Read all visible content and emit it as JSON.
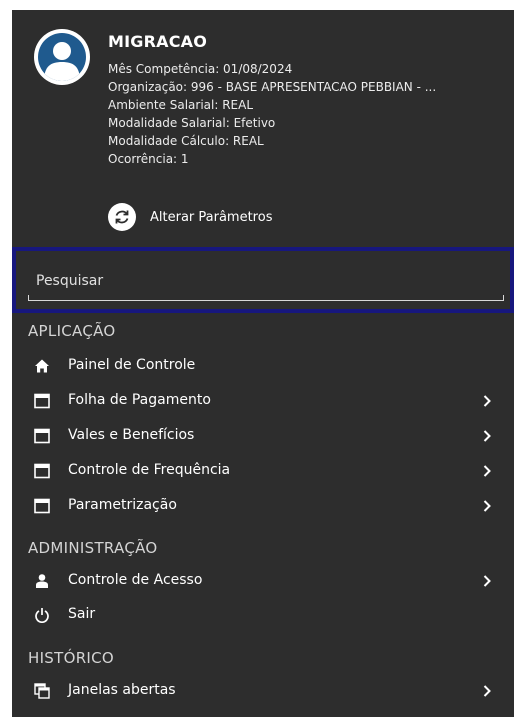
{
  "profile": {
    "name": "MIGRACAO",
    "lines": [
      "Mês Competência: 01/08/2024",
      "Organização: 996 - BASE APRESENTACAO PEBBIAN - ...",
      "Ambiente Salarial: REAL",
      "Modalidade Salarial: Efetivo",
      "Modalidade Cálculo: REAL",
      "Ocorrência: 1"
    ],
    "change_params_label": "Alterar Parâmetros"
  },
  "search": {
    "placeholder": "Pesquisar",
    "value": ""
  },
  "sections": {
    "aplicacao": {
      "title": "APLICAÇÃO",
      "items": [
        {
          "label": "Painel de Controle",
          "icon": "home-icon",
          "has_submenu": false
        },
        {
          "label": "Folha de Pagamento",
          "icon": "window-icon",
          "has_submenu": true
        },
        {
          "label": "Vales e Benefícios",
          "icon": "window-icon",
          "has_submenu": true
        },
        {
          "label": "Controle de Frequência",
          "icon": "window-icon",
          "has_submenu": true
        },
        {
          "label": "Parametrização",
          "icon": "window-icon",
          "has_submenu": true
        }
      ]
    },
    "administracao": {
      "title": "ADMINISTRAÇÃO",
      "items": [
        {
          "label": "Controle de Acesso",
          "icon": "user-icon",
          "has_submenu": true
        },
        {
          "label": "Sair",
          "icon": "power-icon",
          "has_submenu": false
        }
      ]
    },
    "historico": {
      "title": "HISTÓRICO",
      "items": [
        {
          "label": "Janelas abertas",
          "icon": "windows-stack-icon",
          "has_submenu": true
        }
      ]
    }
  },
  "colors": {
    "panel_bg": "#2d2d2d",
    "search_border": "#17177e",
    "avatar_bg": "#1f5a8e",
    "text": "#ffffff"
  }
}
